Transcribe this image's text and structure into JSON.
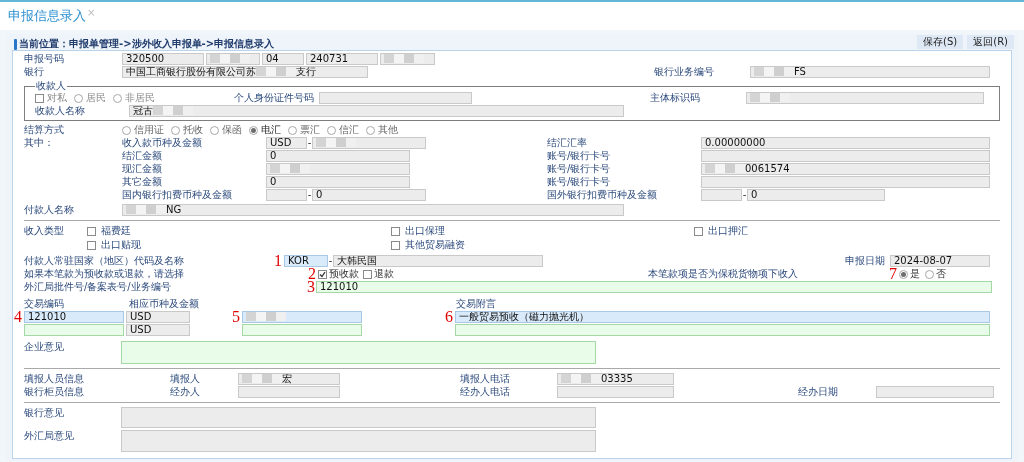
{
  "tab": {
    "title": "申报信息录入",
    "close_glyph": "×"
  },
  "breadcrumb": "当前位置：申报单管理->涉外收入申报单->申报信息录入",
  "buttons": [
    "保存(S)",
    "返回(R)"
  ],
  "report_number": {
    "label": "申报号码",
    "parts": [
      {
        "segments": [
          {
            "kind": "text",
            "value": "320500"
          }
        ]
      },
      {
        "segments": [
          {
            "kind": "redacted"
          }
        ]
      },
      {
        "segments": [
          {
            "kind": "text",
            "value": "04"
          }
        ]
      },
      {
        "segments": [
          {
            "kind": "text",
            "value": "240731"
          }
        ]
      },
      {
        "segments": [
          {
            "kind": "redacted"
          }
        ]
      }
    ]
  },
  "bank": {
    "label": "银行",
    "segments": [
      {
        "kind": "text",
        "value": "中国工商银行股份有限公司苏"
      },
      {
        "kind": "redacted"
      },
      {
        "kind": "text",
        "value": "支行"
      }
    ]
  },
  "bank_ref": {
    "label": "银行业务编号",
    "segments": [
      {
        "kind": "redacted"
      },
      {
        "kind": "text",
        "value": "FS"
      }
    ]
  },
  "payee": {
    "legend": "收款人",
    "options": [
      {
        "kind": "checkbox",
        "label": "对私",
        "selected": false
      },
      {
        "kind": "radio",
        "label": "居民",
        "selected": false
      },
      {
        "kind": "radio",
        "label": "非居民",
        "selected": false
      }
    ],
    "id_label": "个人身份证件号码",
    "entity_label": "主体标识码",
    "entity_segments": [
      {
        "kind": "redacted"
      }
    ],
    "name_label": "收款人名称",
    "name_segments": [
      {
        "kind": "text",
        "value": "冠古"
      },
      {
        "kind": "redacted"
      }
    ]
  },
  "settlement": {
    "label": "结算方式",
    "options": [
      {
        "label": "信用证",
        "selected": false
      },
      {
        "label": "托收",
        "selected": false
      },
      {
        "label": "保函",
        "selected": false
      },
      {
        "label": "电汇",
        "selected": true
      },
      {
        "label": "票汇",
        "selected": false
      },
      {
        "label": "信汇",
        "selected": false
      },
      {
        "label": "其他",
        "selected": false
      }
    ]
  },
  "of_which": {
    "label": "其中：",
    "rows": [
      {
        "left": {
          "label": "收入款币种及金额",
          "kind": "pair",
          "separator": "-",
          "currency": "USD",
          "amount_segments": [
            {
              "kind": "redacted"
            }
          ]
        },
        "right": {
          "label": "结汇汇率",
          "kind": "single",
          "segments": [
            {
              "kind": "text",
              "value": "0.00000000"
            }
          ]
        }
      },
      {
        "left": {
          "label": "结汇金额",
          "kind": "single",
          "segments": [
            {
              "kind": "text",
              "value": "0"
            }
          ]
        },
        "right": {
          "label": "账号/银行卡号",
          "kind": "single"
        }
      },
      {
        "left": {
          "label": "现汇金额",
          "kind": "single",
          "segments": [
            {
              "kind": "redacted"
            }
          ]
        },
        "right": {
          "label": "账号/银行卡号",
          "kind": "single",
          "segments": [
            {
              "kind": "redacted"
            },
            {
              "kind": "text",
              "value": "0061574"
            }
          ]
        }
      },
      {
        "left": {
          "label": "其它金额",
          "kind": "single",
          "segments": [
            {
              "kind": "text",
              "value": "0"
            }
          ]
        },
        "right": {
          "label": "账号/银行卡号",
          "kind": "single"
        }
      },
      {
        "left": {
          "label": "国内银行扣费币种及金额",
          "kind": "pair",
          "separator": "-",
          "amount_segments": [
            {
              "kind": "text",
              "value": "0"
            }
          ]
        },
        "right": {
          "label": "国外银行扣费币种及金额",
          "kind": "pair",
          "separator": "-",
          "amount_segments": [
            {
              "kind": "text",
              "value": "0"
            }
          ]
        }
      }
    ]
  },
  "payer": {
    "label": "付款人名称",
    "segments": [
      {
        "kind": "redacted"
      },
      {
        "kind": "text",
        "value": "NG"
      }
    ]
  },
  "income_type": {
    "label": "收入类型",
    "options": [
      {
        "label": "福费廷",
        "checked": false
      },
      {
        "label": "出口保理",
        "checked": false
      },
      {
        "label": "出口押汇",
        "checked": false
      },
      {
        "label": "出口贴现",
        "checked": false
      },
      {
        "label": "其他贸易融资",
        "checked": false
      }
    ]
  },
  "country": {
    "label": "付款人常驻国家（地区）代码及名称",
    "marker": "1",
    "code": "KOR",
    "separator": "-",
    "name": "大韩民国"
  },
  "report_date": {
    "label": "申报日期",
    "value": "2024-08-07"
  },
  "prepay": {
    "label": "如果本笔款为预收款或退款，请选择",
    "marker": "2",
    "options": [
      {
        "label": "预收款",
        "checked": true
      },
      {
        "label": "退款",
        "checked": false
      }
    ]
  },
  "bonded": {
    "label": "本笔款项是否为保税货物项下收入",
    "marker": "7",
    "options": [
      {
        "label": "是",
        "selected": true
      },
      {
        "label": "否",
        "selected": false
      }
    ]
  },
  "approval": {
    "label": "外汇局批件号/备案表号/业务编号",
    "marker": "3",
    "value": "121010"
  },
  "transactions": {
    "headers": [
      "交易编码",
      "相应币种及金额",
      "交易附言"
    ],
    "rows": [
      {
        "code_marker": "4",
        "code": "121010",
        "currency": "USD",
        "amount_marker": "5",
        "amount_segments": [
          {
            "kind": "redacted"
          }
        ],
        "remark_marker": "6",
        "remark": "一般贸易预收（磁力抛光机）"
      },
      {
        "currency": "USD"
      }
    ]
  },
  "enterprise_opinion": {
    "label": "企业意见"
  },
  "filer": {
    "label": "填报人员信息",
    "name_label": "填报人",
    "name_segments": [
      {
        "kind": "redacted"
      },
      {
        "kind": "text",
        "value": "宏"
      }
    ],
    "phone_label": "填报人电话",
    "phone_segments": [
      {
        "kind": "redacted"
      },
      {
        "kind": "text",
        "value": "03335"
      }
    ]
  },
  "teller": {
    "label": "银行柜员信息",
    "name_label": "经办人",
    "phone_label": "经办人电话",
    "date_label": "经办日期"
  },
  "bank_opinion": {
    "label": "银行意见"
  },
  "safe_opinion": {
    "label": "外汇局意见"
  }
}
